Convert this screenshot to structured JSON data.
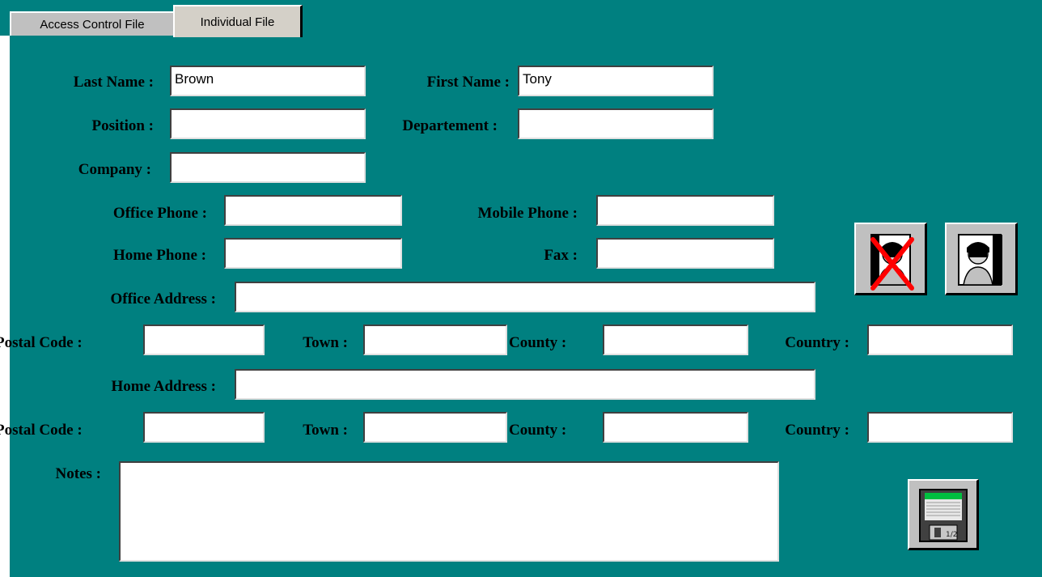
{
  "tabs": [
    {
      "label": "Access Control File",
      "active": false
    },
    {
      "label": "Individual File",
      "active": true
    }
  ],
  "form": {
    "last_name": {
      "label": "Last Name :",
      "value": "Brown"
    },
    "first_name": {
      "label": "First Name :",
      "value": "Tony"
    },
    "position": {
      "label": "Position :",
      "value": ""
    },
    "department": {
      "label": "Departement :",
      "value": ""
    },
    "company": {
      "label": "Company :",
      "value": ""
    },
    "office_phone": {
      "label": "Office Phone :",
      "value": ""
    },
    "mobile_phone": {
      "label": "Mobile Phone :",
      "value": ""
    },
    "home_phone": {
      "label": "Home Phone :",
      "value": ""
    },
    "fax": {
      "label": "Fax :",
      "value": ""
    },
    "office_address": {
      "label": "Office Address :",
      "value": ""
    },
    "office_postal": {
      "label": "Postal Code :",
      "value": ""
    },
    "office_town": {
      "label": "Town :",
      "value": ""
    },
    "office_county": {
      "label": "County :",
      "value": ""
    },
    "office_country": {
      "label": "Country :",
      "value": ""
    },
    "home_address": {
      "label": "Home Address :",
      "value": ""
    },
    "home_postal": {
      "label": "Postal Code :",
      "value": ""
    },
    "home_town": {
      "label": "Town :",
      "value": ""
    },
    "home_county": {
      "label": "County :",
      "value": ""
    },
    "home_country": {
      "label": "Country :",
      "value": ""
    },
    "notes": {
      "label": "Notes :",
      "value": ""
    }
  },
  "buttons": {
    "delete_person": {
      "icon": "person-delete-icon"
    },
    "person_file": {
      "icon": "person-icon"
    },
    "save": {
      "icon": "floppy-disk-icon"
    }
  },
  "colors": {
    "background": "#008080",
    "button_face": "#c0c0c0",
    "delete_mark": "#ff0000"
  }
}
